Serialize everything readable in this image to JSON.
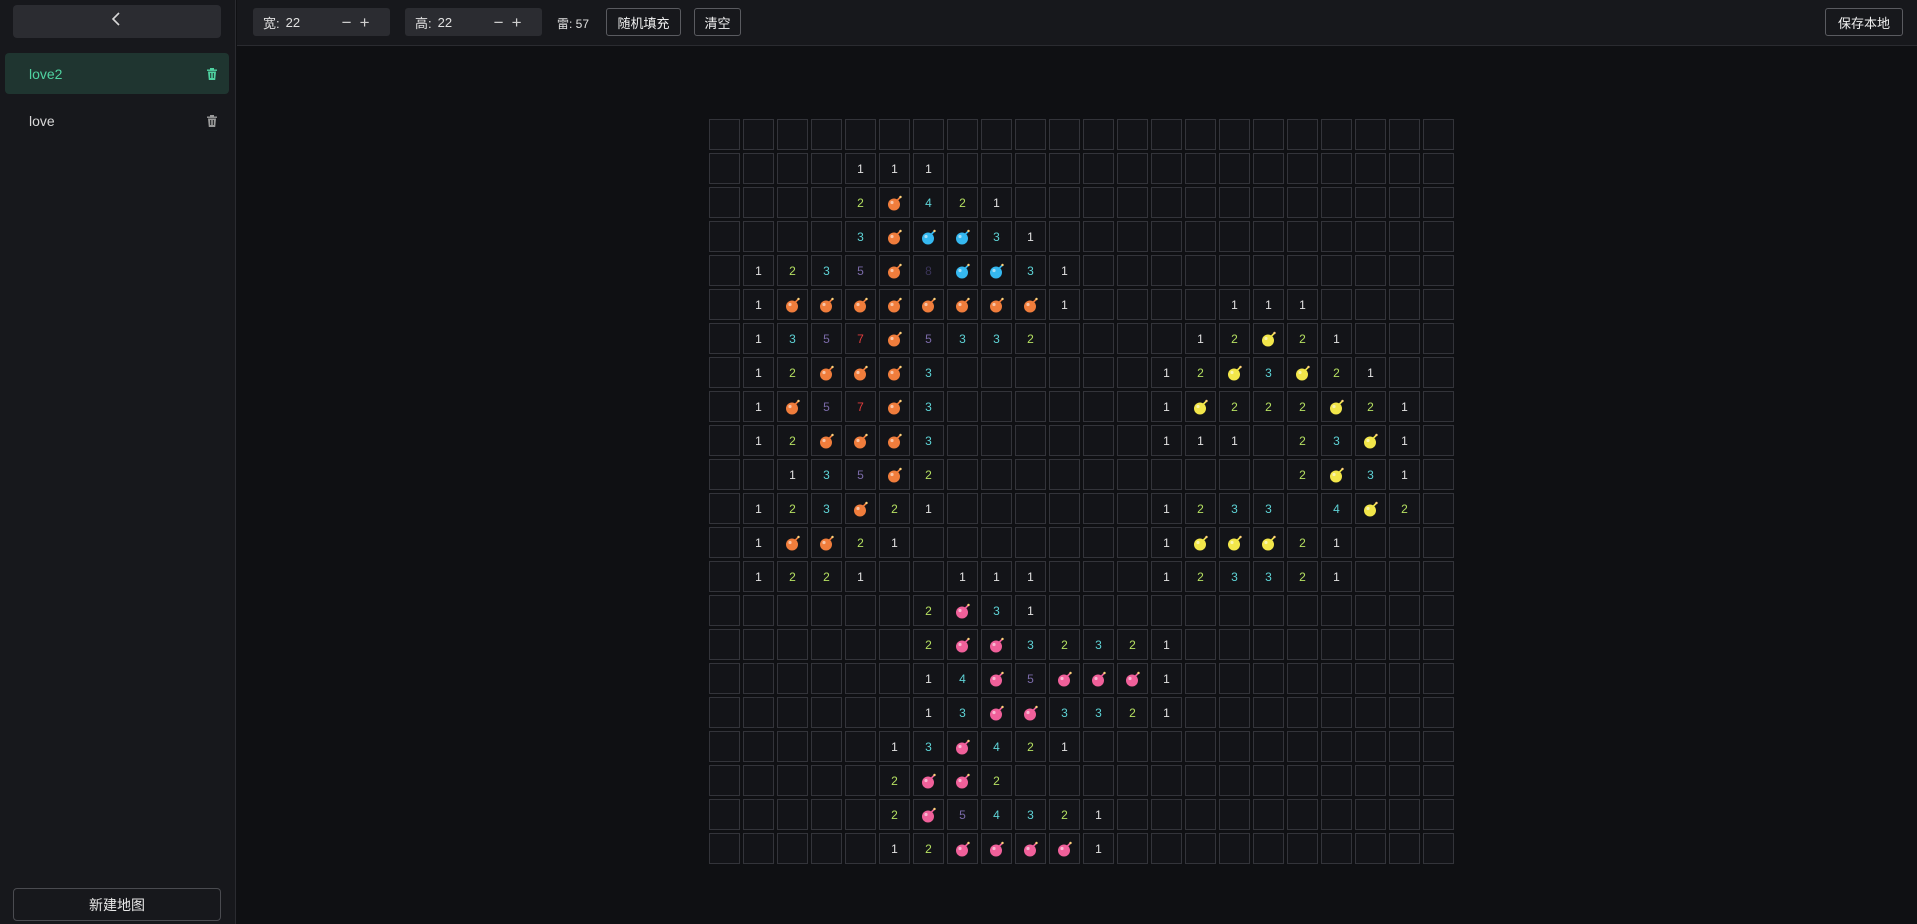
{
  "sidebar": {
    "back_icon": "chevron-left-icon",
    "maps": [
      {
        "label": "love2",
        "active": true,
        "icon": "trash-icon"
      },
      {
        "label": "love",
        "active": false,
        "icon": "trash-icon"
      }
    ],
    "new_map_label": "新建地图"
  },
  "toolbar": {
    "width_label": "宽:",
    "width_value": "22",
    "height_label": "高:",
    "height_value": "22",
    "mines_label": "雷: 57",
    "random_fill_label": "随机填充",
    "clear_label": "清空",
    "save_label": "保存本地"
  },
  "colors": {
    "accent": "#4fd3a1",
    "mine_orange": "#f07d3c",
    "mine_blue": "#35b8f0",
    "mine_yellow": "#f2e64a",
    "mine_pink": "#f0609a",
    "num1": "#e2e2e2",
    "num2": "#b5e061",
    "num3": "#5ed3d6",
    "num4": "#5ed3d6",
    "num5": "#7a6aa8",
    "num7": "#e23c3c",
    "num8": "#3a3458"
  },
  "board": {
    "cols": 22,
    "rows": [
      "......................",
      "....111...............",
      "....2o421.............",
      "....3obb31............",
      ".1235o8bb31...........",
      ".1oooooooo1....111....",
      ".1357o5332l...12y21...",
      ".12ooo3......12y3y21..",
      ".1o57o3......1y222y21.",
      ".12ooo3......111.23y1.",
      "..135o2..........2y31.",
      ".123o21......1233 4y2.",
      ".1oo21.......1yyy21...",
      ".1221..111...123321...",
      "......2p31............",
      "......2pp32321........",
      "......14p5ppp1........",
      "......13pp3321........",
      ".....13p421...........",
      ".....2pp2.............",
      ".....2p54321..........",
      ".....12pppp1.........."
    ]
  }
}
